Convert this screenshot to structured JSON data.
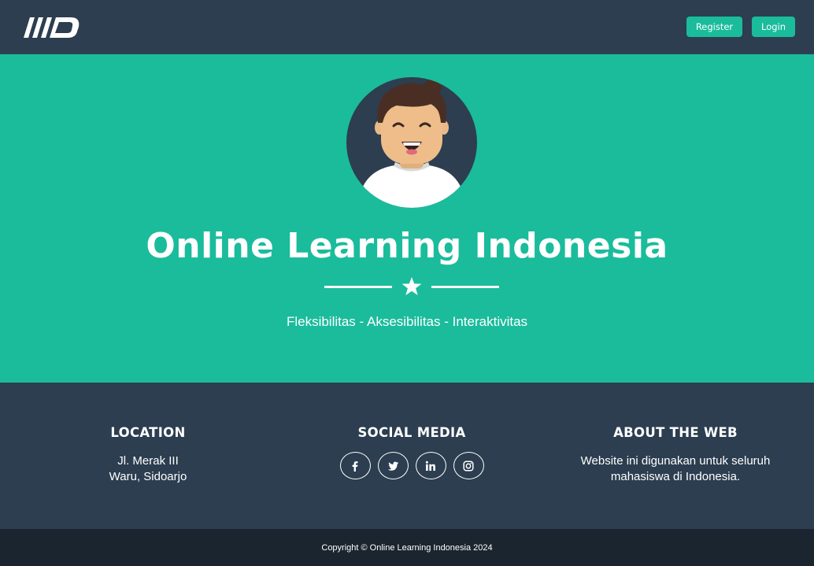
{
  "navbar": {
    "logo_icon": "md-logo-icon",
    "register_label": "Register",
    "login_label": "Login"
  },
  "hero": {
    "avatar_icon": "smiling-man-avatar-icon",
    "title": "Online Learning Indonesia",
    "divider_icon": "star-icon",
    "subtitle": "Fleksibilitas - Aksesibilitas - Interaktivitas"
  },
  "footer": {
    "location": {
      "heading": "LOCATION",
      "line1": "Jl. Merak III",
      "line2": "Waru, Sidoarjo"
    },
    "social": {
      "heading": "SOCIAL MEDIA",
      "icons": [
        "facebook-icon",
        "twitter-icon",
        "linkedin-icon",
        "instagram-icon"
      ]
    },
    "about": {
      "heading": "ABOUT THE WEB",
      "line1": "Website ini digunakan untuk seluruh",
      "line2": "mahasiswa di Indonesia."
    }
  },
  "copyright": "Copyright © Online Learning Indonesia 2024",
  "colors": {
    "primary": "#1abc9c",
    "dark": "#2c3e50",
    "darker": "#1a252f",
    "white": "#ffffff"
  }
}
